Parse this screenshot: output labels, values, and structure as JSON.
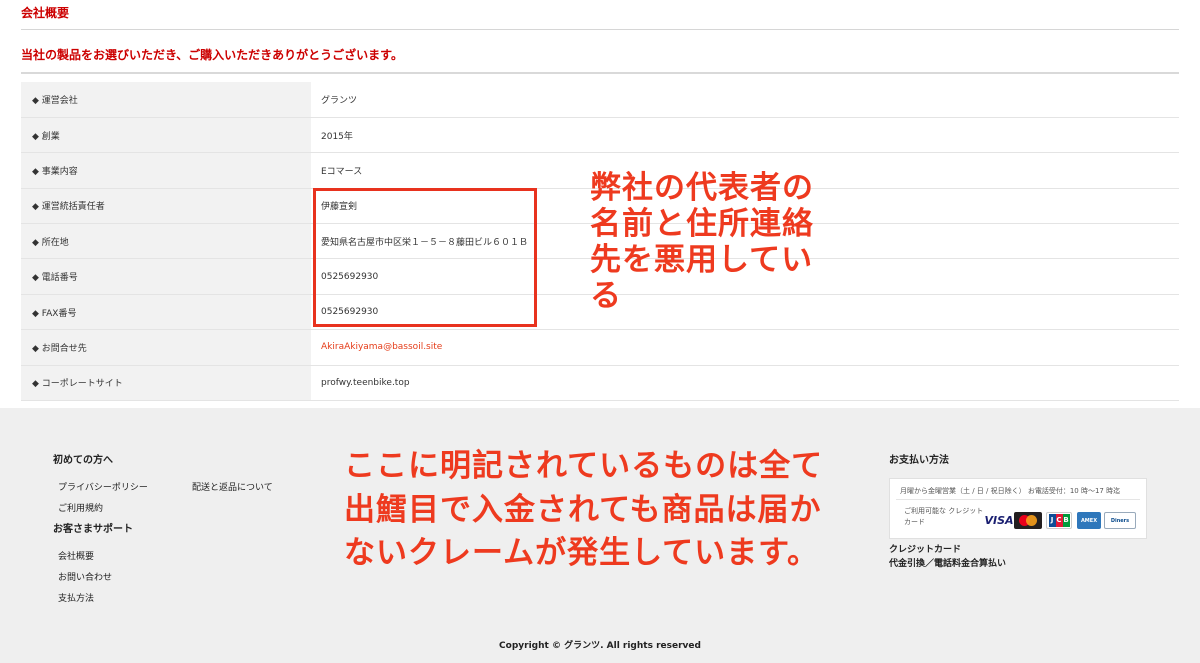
{
  "page": {
    "title": "会社概要",
    "thanks_message": "当社の製品をお選びいただき、ご購入いただきありがとうございます。"
  },
  "company_table": [
    {
      "label": "◆ 運営会社",
      "value": "グランツ"
    },
    {
      "label": "◆ 創業",
      "value": "2015年"
    },
    {
      "label": "◆ 事業内容",
      "value": "Eコマース"
    },
    {
      "label": "◆ 運営統括責任者",
      "value": "伊藤宣剣"
    },
    {
      "label": "◆ 所在地",
      "value": "愛知県名古屋市中区栄１－５－８藤田ビル６０１Ｂ"
    },
    {
      "label": "◆ 電話番号",
      "value": "0525692930"
    },
    {
      "label": "◆ FAX番号",
      "value": "0525692930"
    },
    {
      "label": "◆ お問合せ先",
      "value": "AkiraAkiyama@bassoil.site"
    },
    {
      "label": "◆ コーポレートサイト",
      "value": "profwy.teenbike.top"
    }
  ],
  "annotations": {
    "note1": "弊社の代表者の名前と住所連絡先を悪用している",
    "note2": "ここに明記されているものは全て出鱈目で入金されても商品は届かないクレームが発生しています。",
    "color": "#ee3a1f"
  },
  "footer": {
    "first_time": {
      "heading": "初めての方へ",
      "links": [
        "プライバシーポリシー",
        "配送と返品について",
        "ご利用規約"
      ]
    },
    "support": {
      "heading": "お客さまサポート",
      "links": [
        "会社概要",
        "お問い合わせ",
        "支払方法"
      ]
    },
    "payment": {
      "heading": "お支払い方法",
      "hours": "月曜から金曜営業（土 / 日 / 祝日除く） お電話受付：10 時〜17 時迄",
      "card_label": "ご利用可能な クレジットカード",
      "cards": {
        "visa": "VISA",
        "mastercard": "MasterCard",
        "jcb": "JCB",
        "amex": "AMERICAN EXPRESS",
        "diners": "Diners Club"
      },
      "methods": [
        "クレジットカード",
        "代金引換／電話料金合算払い"
      ]
    },
    "copyright": "Copyright © グランツ. All rights reserved"
  },
  "colors": {
    "accent_red": "#cc0000",
    "link_red": "#e53d1a",
    "footer_bg": "#efefef",
    "label_bg": "#f2f2f2"
  }
}
